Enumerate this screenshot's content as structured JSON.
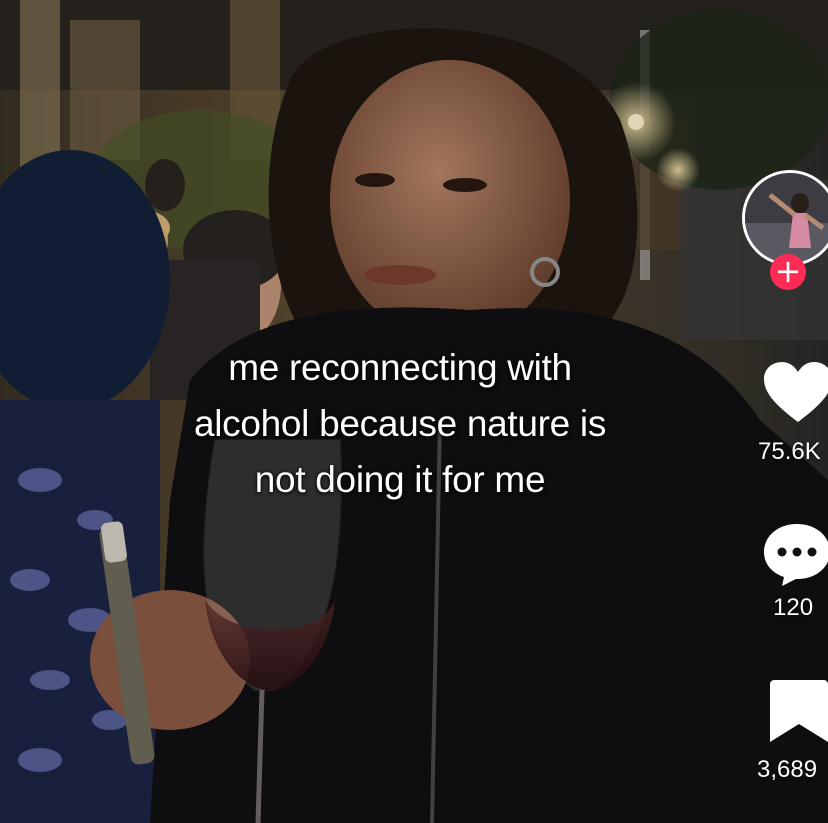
{
  "caption": {
    "line1": "me reconnecting with",
    "line2": "alcohol because nature is",
    "line3": "not doing it for me"
  },
  "actions": {
    "like": {
      "icon": "heart-icon",
      "count": "75.6K"
    },
    "comment": {
      "icon": "comment-bubble-icon",
      "count": "120"
    },
    "save": {
      "icon": "bookmark-icon",
      "count": "3,689"
    },
    "follow": {
      "icon": "plus-icon",
      "label": "+"
    }
  },
  "colors": {
    "follow_accent": "#fe2c55",
    "icon": "#ffffff"
  }
}
